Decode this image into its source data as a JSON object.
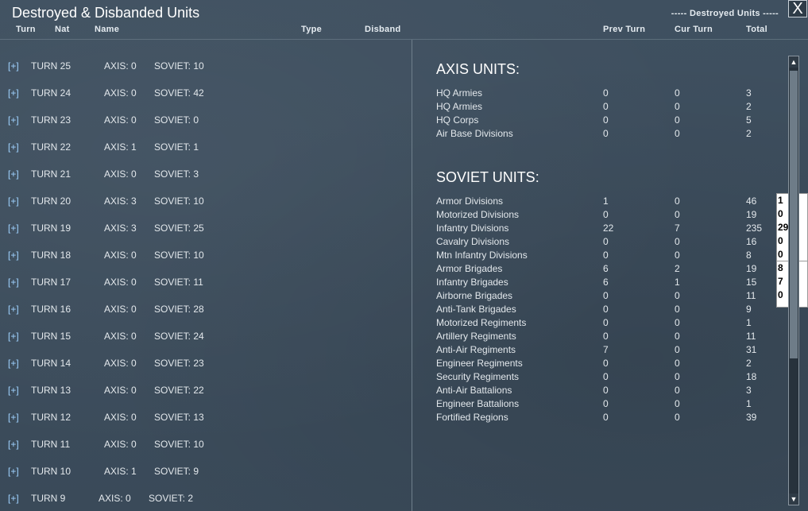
{
  "window": {
    "title": "Destroyed & Disbanded Units",
    "close_label": "X",
    "destroyed_header": "----- Destroyed Units -----"
  },
  "columns": {
    "turn": "Turn",
    "nat": "Nat",
    "name": "Name",
    "type": "Type",
    "disband": "Disband",
    "prev_turn": "Prev Turn",
    "cur_turn": "Cur Turn",
    "total": "Total"
  },
  "turns": [
    {
      "expander": "[+]",
      "turn": "TURN 25",
      "axis": "AXIS: 0",
      "soviet": "SOVIET: 10"
    },
    {
      "expander": "[+]",
      "turn": "TURN 24",
      "axis": "AXIS: 0",
      "soviet": "SOVIET: 42"
    },
    {
      "expander": "[+]",
      "turn": "TURN 23",
      "axis": "AXIS: 0",
      "soviet": "SOVIET: 0"
    },
    {
      "expander": "[+]",
      "turn": "TURN 22",
      "axis": "AXIS: 1",
      "soviet": "SOVIET: 1"
    },
    {
      "expander": "[+]",
      "turn": "TURN 21",
      "axis": "AXIS: 0",
      "soviet": "SOVIET: 3"
    },
    {
      "expander": "[+]",
      "turn": "TURN 20",
      "axis": "AXIS: 3",
      "soviet": "SOVIET: 10"
    },
    {
      "expander": "[+]",
      "turn": "TURN 19",
      "axis": "AXIS: 3",
      "soviet": "SOVIET: 25"
    },
    {
      "expander": "[+]",
      "turn": "TURN 18",
      "axis": "AXIS: 0",
      "soviet": "SOVIET: 10"
    },
    {
      "expander": "[+]",
      "turn": "TURN 17",
      "axis": "AXIS: 0",
      "soviet": "SOVIET: 11"
    },
    {
      "expander": "[+]",
      "turn": "TURN 16",
      "axis": "AXIS: 0",
      "soviet": "SOVIET: 28"
    },
    {
      "expander": "[+]",
      "turn": "TURN 15",
      "axis": "AXIS: 0",
      "soviet": "SOVIET: 24"
    },
    {
      "expander": "[+]",
      "turn": "TURN 14",
      "axis": "AXIS: 0",
      "soviet": "SOVIET: 23"
    },
    {
      "expander": "[+]",
      "turn": "TURN 13",
      "axis": "AXIS: 0",
      "soviet": "SOVIET: 22"
    },
    {
      "expander": "[+]",
      "turn": "TURN 12",
      "axis": "AXIS: 0",
      "soviet": "SOVIET: 13"
    },
    {
      "expander": "[+]",
      "turn": "TURN 11",
      "axis": "AXIS: 0",
      "soviet": "SOVIET: 10"
    },
    {
      "expander": "[+]",
      "turn": "TURN 10",
      "axis": "AXIS: 1",
      "soviet": "SOVIET: 9"
    },
    {
      "expander": "[+]",
      "turn": "TURN 9",
      "axis": "AXIS: 0",
      "soviet": "SOVIET: 2"
    }
  ],
  "axis_units": {
    "title": "AXIS UNITS:",
    "rows": [
      {
        "name": "HQ Armies",
        "prev": "0",
        "cur": "0",
        "total": "3"
      },
      {
        "name": "HQ Armies",
        "prev": "0",
        "cur": "0",
        "total": "2"
      },
      {
        "name": "HQ Corps",
        "prev": "0",
        "cur": "0",
        "total": "5"
      },
      {
        "name": "Air Base Divisions",
        "prev": "0",
        "cur": "0",
        "total": "2"
      }
    ]
  },
  "soviet_units": {
    "title": "SOVIET UNITS:",
    "rows": [
      {
        "name": "Armor Divisions",
        "prev": "1",
        "cur": "0",
        "total": "46"
      },
      {
        "name": "Motorized Divisions",
        "prev": "0",
        "cur": "0",
        "total": "19"
      },
      {
        "name": "Infantry Divisions",
        "prev": "22",
        "cur": "7",
        "total": "235"
      },
      {
        "name": "Cavalry Divisions",
        "prev": "0",
        "cur": "0",
        "total": "16"
      },
      {
        "name": "Mtn Infantry Divisions",
        "prev": "0",
        "cur": "0",
        "total": "8"
      },
      {
        "name": "Armor Brigades",
        "prev": "6",
        "cur": "2",
        "total": "19"
      },
      {
        "name": "Infantry Brigades",
        "prev": "6",
        "cur": "1",
        "total": "15"
      },
      {
        "name": "Airborne Brigades",
        "prev": "0",
        "cur": "0",
        "total": "11"
      },
      {
        "name": "Anti-Tank Brigades",
        "prev": "0",
        "cur": "0",
        "total": "9"
      },
      {
        "name": "Motorized Regiments",
        "prev": "0",
        "cur": "0",
        "total": "1"
      },
      {
        "name": "Artillery Regiments",
        "prev": "0",
        "cur": "0",
        "total": "11"
      },
      {
        "name": "Anti-Air Regiments",
        "prev": "7",
        "cur": "0",
        "total": "31"
      },
      {
        "name": "Engineer Regiments",
        "prev": "0",
        "cur": "0",
        "total": "2"
      },
      {
        "name": "Security Regiments",
        "prev": "0",
        "cur": "0",
        "total": "18"
      },
      {
        "name": "Anti-Air Battalions",
        "prev": "0",
        "cur": "0",
        "total": "3"
      },
      {
        "name": "Engineer Battalions",
        "prev": "0",
        "cur": "0",
        "total": "1"
      },
      {
        "name": "Fortified Regions",
        "prev": "0",
        "cur": "0",
        "total": "39"
      }
    ]
  },
  "popup_a": [
    "1",
    "0",
    "29",
    "0",
    "0"
  ],
  "popup_b": [
    "8",
    "7",
    "0"
  ],
  "scrollbar": {
    "up": "▲",
    "down": "▼"
  }
}
